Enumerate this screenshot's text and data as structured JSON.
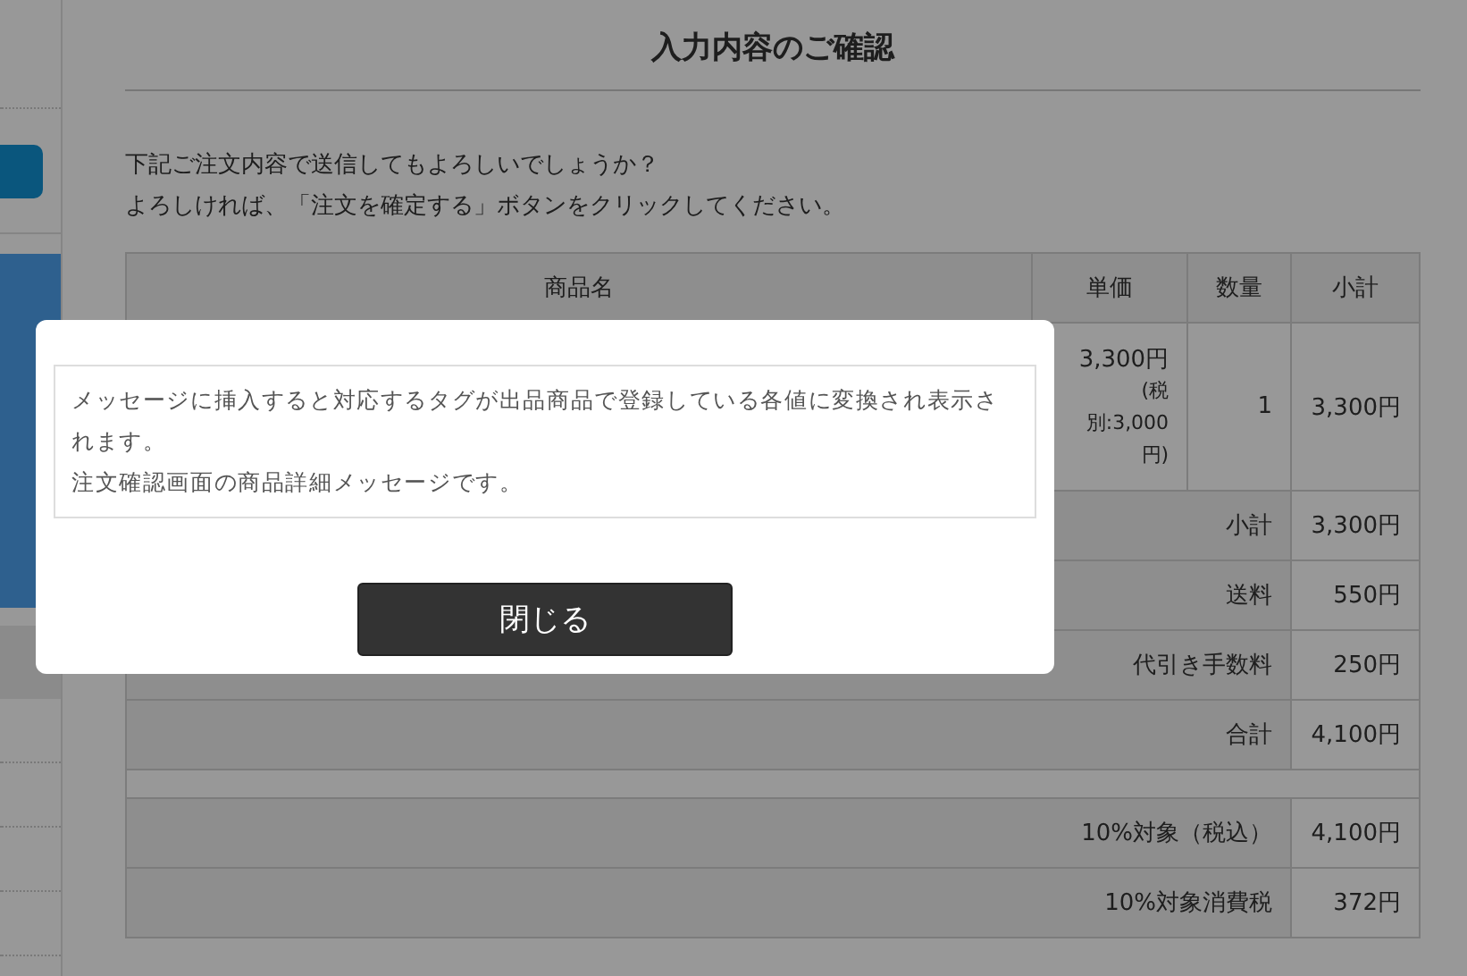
{
  "page": {
    "title": "入力内容のご確認",
    "intro": [
      "下記ご注文内容で送信してもよろしいでしょうか？",
      "よろしければ、「注文を確定する」ボタンをクリックしてください。"
    ]
  },
  "order_table": {
    "columns": [
      "商品名",
      "単価",
      "数量",
      "小計"
    ],
    "items": [
      {
        "unit_price": "3,300円",
        "tax_excluded": "(税別:3,000円)",
        "quantity": "1",
        "subtotal": "3,300円"
      }
    ],
    "summary": [
      {
        "label": "小計",
        "value": "3,300円"
      },
      {
        "label": "送料",
        "value": "550円"
      },
      {
        "label": "代引き手数料",
        "value": "250円"
      },
      {
        "label": "合計",
        "value": "4,100円"
      }
    ],
    "tax_summary": [
      {
        "label": "10%対象（税込）",
        "value": "4,100円"
      },
      {
        "label": "10%対象消費税",
        "value": "372円"
      }
    ]
  },
  "modal": {
    "message": [
      "メッセージに挿入すると対応するタグが出品商品で登録している各値に変換され表示されます。",
      "注文確認画面の商品詳細メッセージです。"
    ],
    "button": "閉じる"
  }
}
